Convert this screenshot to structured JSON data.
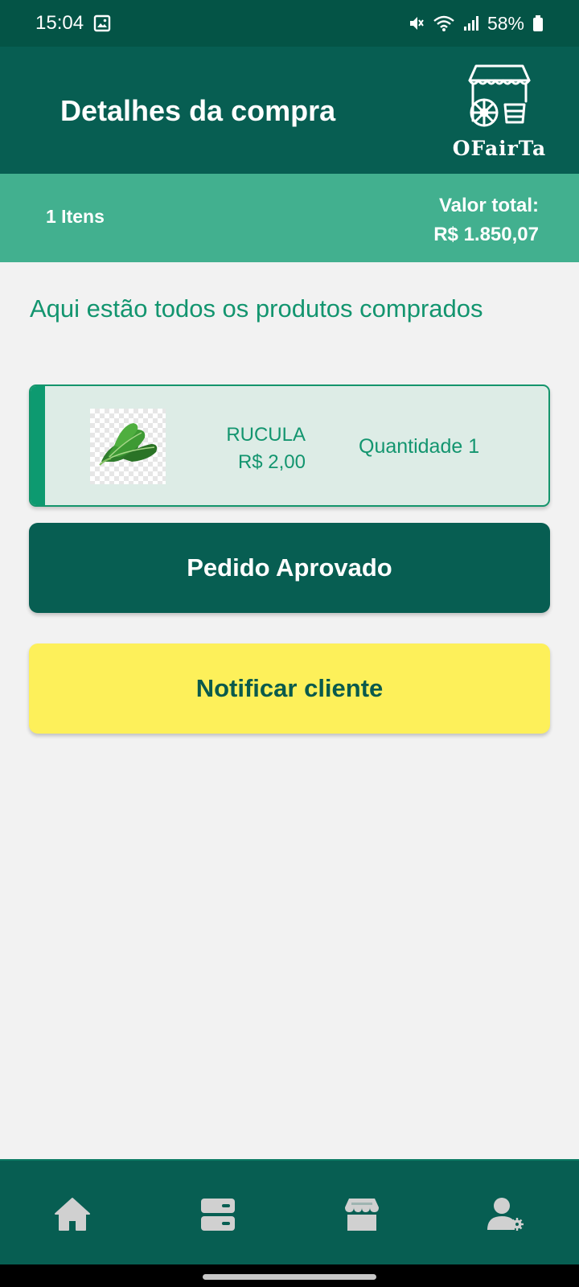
{
  "status_bar": {
    "time": "15:04",
    "battery": "58%",
    "icons": [
      "image-icon",
      "mute-icon",
      "wifi-icon",
      "signal-icon",
      "battery-icon"
    ]
  },
  "header": {
    "title": "Detalhes da compra",
    "brand_name": "OFairTa"
  },
  "summary": {
    "items_count": "1 Itens",
    "total_label": "Valor total:",
    "total_value": "R$ 1.850,07"
  },
  "intro_text": "Aqui estão todos os produtos comprados",
  "products": [
    {
      "name": "RUCULA",
      "price": "R$ 2,00",
      "quantity": "Quantidade 1"
    }
  ],
  "buttons": {
    "approved": "Pedido Aprovado",
    "notify": "Notificar cliente"
  },
  "bottom_nav": {
    "items": [
      "home-icon",
      "list-icon",
      "store-icon",
      "user-settings-icon"
    ]
  },
  "colors": {
    "header": "#075e52",
    "summary": "#42b08f",
    "accent_green": "#13956f",
    "notify_yellow": "#fdf05a",
    "icon_gray": "#d0d0d0"
  }
}
